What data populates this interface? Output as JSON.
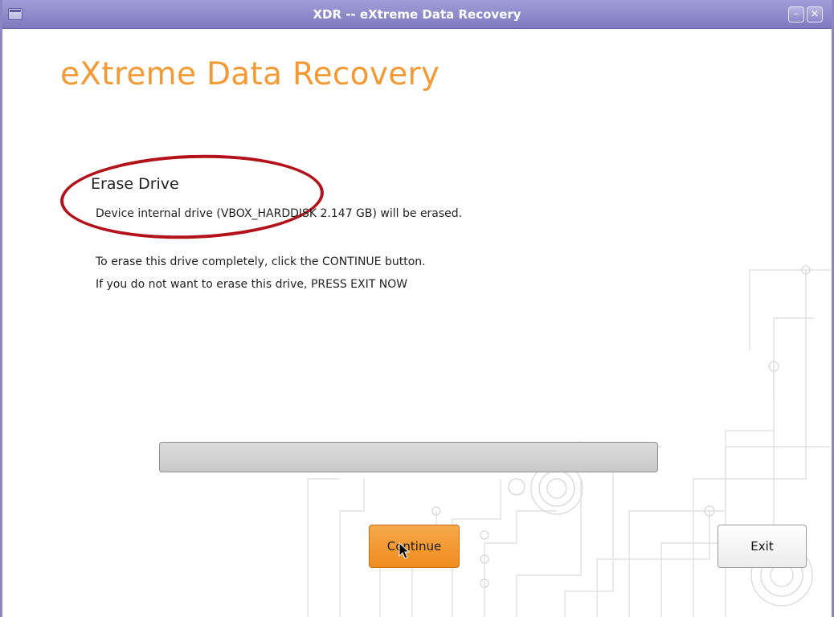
{
  "window": {
    "title": "XDR -- eXtreme Data Recovery",
    "controls": {
      "minimize_icon": "minimize-icon",
      "close_icon": "close-icon",
      "menu_icon": "window-menu-icon"
    },
    "frame_color": "#8c86c4"
  },
  "app": {
    "title": "eXtreme Data Recovery",
    "accent_color": "#f39a35"
  },
  "erase": {
    "heading": "Erase Drive",
    "device_line": "Device internal drive (VBOX_HARDDISK 2.147 GB) will be erased.",
    "instruction_continue": "To erase this drive completely, click the CONTINUE button.",
    "instruction_exit": "If you do not want to erase this drive, PRESS EXIT NOW",
    "highlight_color": "#b3121a"
  },
  "progress": {
    "value": 0
  },
  "buttons": {
    "continue_label": "Continue",
    "exit_label": "Exit"
  }
}
